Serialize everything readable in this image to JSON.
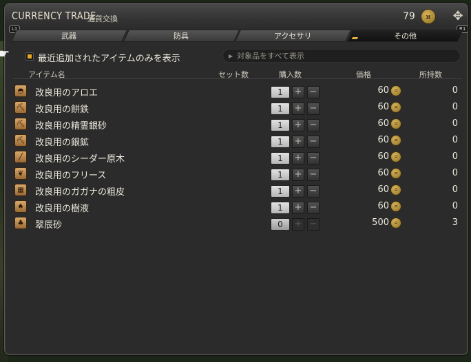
{
  "window": {
    "title": "CURRENCY TRADE",
    "subtitle": "通貨交換",
    "currency_amount": "79",
    "currency_icon": "gil-coin-icon",
    "l1_badge": "L1",
    "r1_badge": "R1"
  },
  "tabs": [
    {
      "label": "武器",
      "active": false
    },
    {
      "label": "防具",
      "active": false
    },
    {
      "label": "アクセサリ",
      "active": false
    },
    {
      "label": "その他",
      "active": true
    }
  ],
  "filter": {
    "checkbox_label": "最近追加されたアイテムのみを表示",
    "checkbox_checked": true,
    "search_placeholder": "対象品をすべて表示"
  },
  "table": {
    "columns": {
      "name": "アイテム名",
      "set_count": "セット数",
      "purchase": "購入数",
      "price": "価格",
      "owned": "所持数"
    },
    "rows": [
      {
        "name": "改良用のアロエ",
        "qty": "1",
        "price": "60",
        "owned": "0",
        "icon": "aloe-icon",
        "disabled": false
      },
      {
        "name": "改良用の餅鉄",
        "qty": "1",
        "price": "60",
        "owned": "0",
        "icon": "pickaxe-icon",
        "disabled": false
      },
      {
        "name": "改良用の精霊銀砂",
        "qty": "1",
        "price": "60",
        "owned": "0",
        "icon": "pickaxe-icon",
        "disabled": false
      },
      {
        "name": "改良用の銀鉱",
        "qty": "1",
        "price": "60",
        "owned": "0",
        "icon": "pickaxe-icon",
        "disabled": false
      },
      {
        "name": "改良用のシーダー原木",
        "qty": "1",
        "price": "60",
        "owned": "0",
        "icon": "log-icon",
        "disabled": false
      },
      {
        "name": "改良用のフリース",
        "qty": "1",
        "price": "60",
        "owned": "0",
        "icon": "fleece-icon",
        "disabled": false
      },
      {
        "name": "改良用のガガナの粗皮",
        "qty": "1",
        "price": "60",
        "owned": "0",
        "icon": "hide-icon",
        "disabled": false
      },
      {
        "name": "改良用の樹液",
        "qty": "1",
        "price": "60",
        "owned": "0",
        "icon": "sap-icon",
        "disabled": false
      },
      {
        "name": "翠辰砂",
        "qty": "0",
        "price": "500",
        "owned": "3",
        "icon": "cinnabar-icon",
        "disabled": true
      }
    ]
  },
  "colors": {
    "accent": "#e8a81e",
    "panel": "#2b2b2b"
  }
}
